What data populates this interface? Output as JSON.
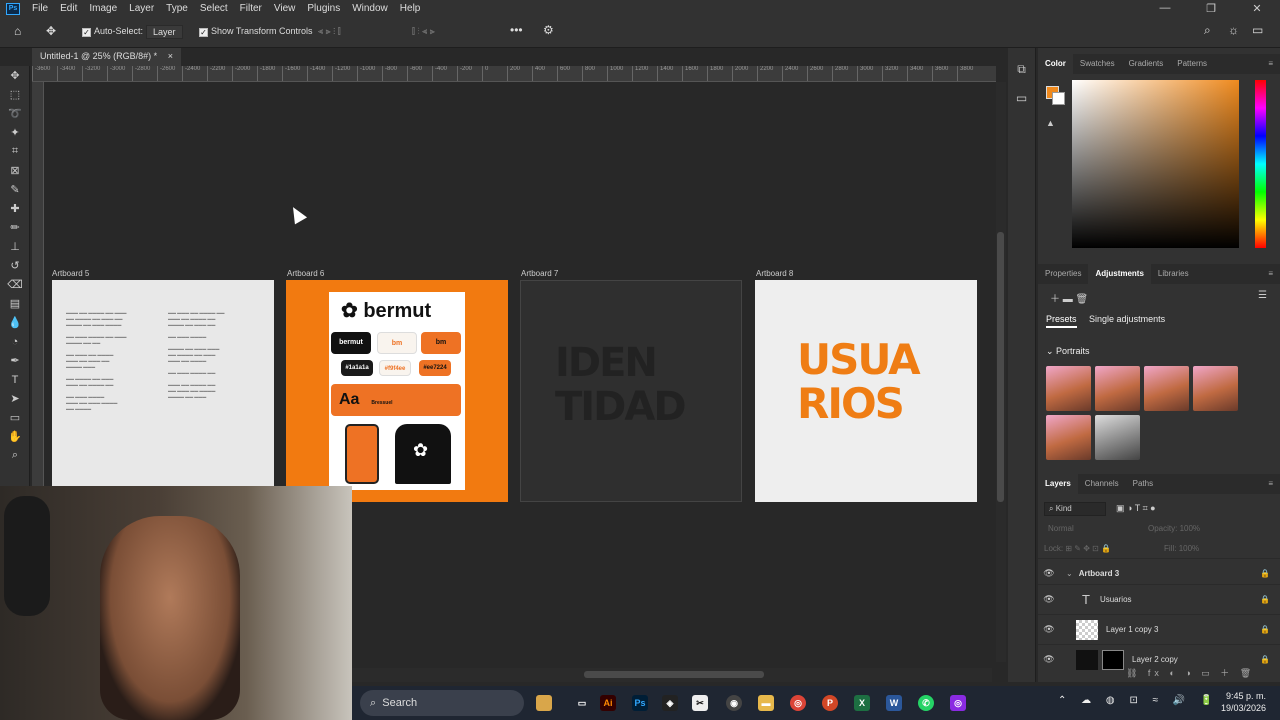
{
  "menubar": {
    "logo": "Ps",
    "items": [
      "File",
      "Edit",
      "Image",
      "Layer",
      "Type",
      "Select",
      "Filter",
      "View",
      "Plugins",
      "Window",
      "Help"
    ],
    "window_controls": [
      "—",
      "❐",
      "✕"
    ]
  },
  "options": {
    "auto_select_label": "Auto-Select:",
    "auto_select_value": "Layer",
    "transform_label": "Show Transform Controls"
  },
  "document": {
    "tab": "Untitled-1 @ 25% (RGB/8#) *",
    "ruler_ticks": [
      "-3600",
      "-3400",
      "-3200",
      "-3000",
      "-2800",
      "-2600",
      "-2400",
      "-2200",
      "-2000",
      "-1800",
      "-1600",
      "-1400",
      "-1200",
      "-1000",
      "-800",
      "-600",
      "-400",
      "-200",
      "0",
      "200",
      "400",
      "600",
      "800",
      "1000",
      "1200",
      "1400",
      "1600",
      "1800",
      "2000",
      "2200",
      "2400",
      "2600",
      "2800",
      "3000",
      "3200",
      "3400",
      "3600",
      "3800"
    ]
  },
  "artboards": [
    {
      "label": "Artboard 5"
    },
    {
      "label": "Artboard 6",
      "brand": "bermut",
      "chips": [
        "bermut",
        "bm",
        "bm",
        "#1a1a1a",
        "#f9f4ee",
        "#ee7224"
      ],
      "type_sample": "Aa",
      "font_label": "Bressuel"
    },
    {
      "label": "Artboard 7",
      "title_line1": "IDEN",
      "title_line2": "TIDAD"
    },
    {
      "label": "Artboard 8",
      "title_line1": "USUA",
      "title_line2": "RIOS"
    }
  ],
  "color_panel": {
    "tabs": [
      "Color",
      "Swatches",
      "Gradients",
      "Patterns"
    ],
    "foreground": "#ef8a1e",
    "background": "#ffffff"
  },
  "adjustments_panel": {
    "tabs": [
      "Properties",
      "Adjustments",
      "Libraries"
    ],
    "subtabs": [
      "Presets",
      "Single adjustments"
    ],
    "group": "Portraits"
  },
  "layers_panel": {
    "tabs": [
      "Layers",
      "Channels",
      "Paths"
    ],
    "filter": "Kind",
    "blend": "Normal",
    "opacity_label": "Opacity:",
    "opacity": "100%",
    "lock_label": "Lock:",
    "fill_label": "Fill:",
    "fill": "100%",
    "layers": [
      {
        "name": "Artboard 3"
      },
      {
        "name": "Usuarios"
      },
      {
        "name": "Layer 1 copy 3"
      },
      {
        "name": "Layer 2 copy"
      }
    ]
  },
  "taskbar": {
    "search": "Search",
    "time": "9:45 p. m.",
    "date": "19/03/2026"
  }
}
